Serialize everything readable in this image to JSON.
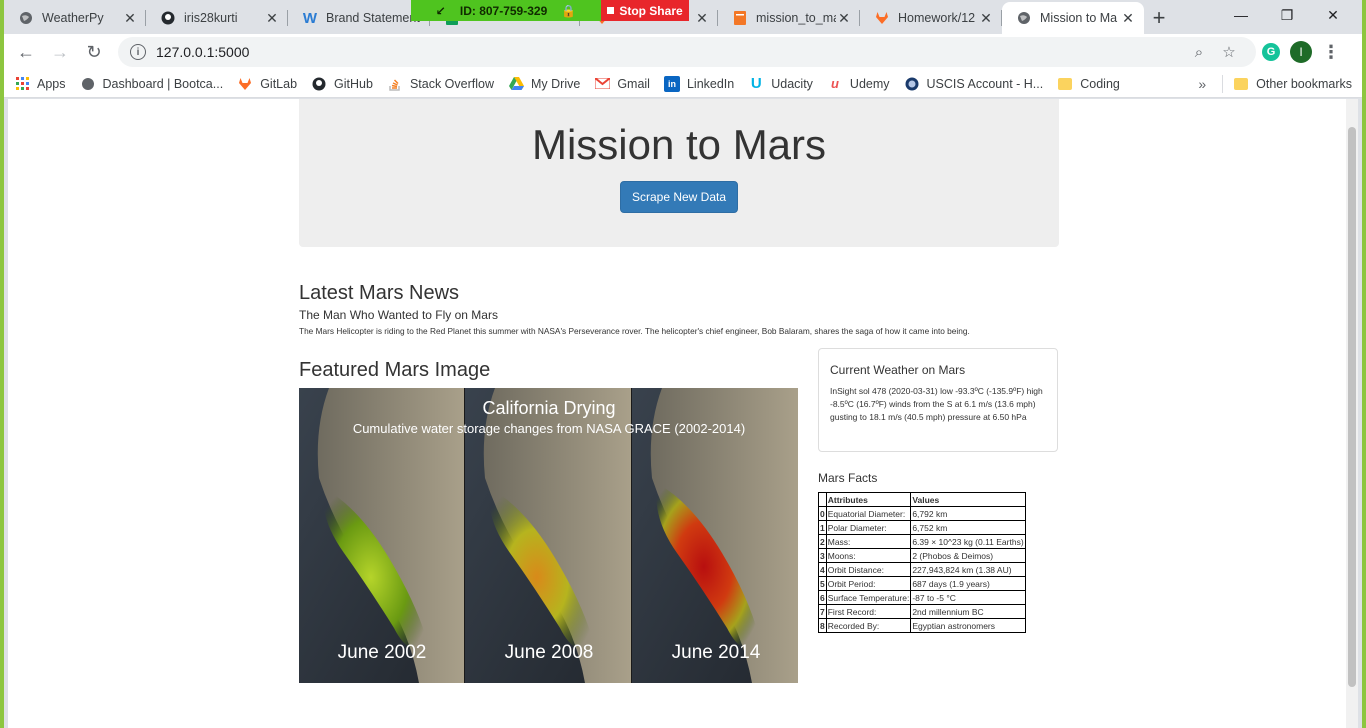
{
  "browser": {
    "tabs": [
      {
        "label": "WeatherPy",
        "icon": "globe-icon"
      },
      {
        "label": "iris28kurti",
        "icon": "github-icon"
      },
      {
        "label": "Brand Statement",
        "icon": "word-icon"
      },
      {
        "label": "",
        "icon": "sheets-icon"
      },
      {
        "label": "",
        "icon": "gitlab-icon"
      },
      {
        "label": "mission_to_ma",
        "icon": "book-icon"
      },
      {
        "label": "Homework/12",
        "icon": "gitlab-icon"
      },
      {
        "label": "Mission to Ma",
        "icon": "globe-icon"
      }
    ],
    "share": {
      "id": "ID: 807-759-329",
      "stop": "Stop Share"
    },
    "url": "127.0.0.1:5000",
    "profile_initial": "I",
    "bookmarks": [
      {
        "label": "Apps",
        "icon": "apps-grid-icon"
      },
      {
        "label": "Dashboard | Bootca...",
        "icon": "globe-icon"
      },
      {
        "label": "GitLab",
        "icon": "gitlab-icon"
      },
      {
        "label": "GitHub",
        "icon": "github-icon"
      },
      {
        "label": "Stack Overflow",
        "icon": "stackoverflow-icon"
      },
      {
        "label": "My Drive",
        "icon": "drive-icon"
      },
      {
        "label": "Gmail",
        "icon": "gmail-icon"
      },
      {
        "label": "LinkedIn",
        "icon": "linkedin-icon"
      },
      {
        "label": "Udacity",
        "icon": "udacity-icon"
      },
      {
        "label": "Udemy",
        "icon": "udemy-icon"
      },
      {
        "label": "USCIS Account - H...",
        "icon": "seal-icon"
      },
      {
        "label": "Coding",
        "icon": "folder-icon"
      }
    ],
    "other_bookmarks": "Other bookmarks"
  },
  "page": {
    "title": "Mission to Mars",
    "scrape_button": "Scrape New Data",
    "news_heading": "Latest Mars News",
    "news_title": "The Man Who Wanted to Fly on Mars",
    "news_paragraph": "The Mars Helicopter is riding to the Red Planet this summer with NASA's Perseverance rover. The helicopter's chief engineer, Bob Balaram, shares the saga of how it came into being.",
    "featured_heading": "Featured Mars Image",
    "featured_image": {
      "title": "California Drying",
      "subtitle": "Cumulative water storage changes from NASA GRACE (2002-2014)",
      "panels": [
        "June 2002",
        "June 2008",
        "June 2014"
      ]
    },
    "weather": {
      "heading": "Current Weather on Mars",
      "text": "InSight sol 478 (2020-03-31) low -93.3ºC (-135.9ºF) high -8.5ºC (16.7ºF) winds from the S at 6.1 m/s (13.6 mph) gusting to 18.1 m/s (40.5 mph) pressure at 6.50 hPa"
    },
    "facts": {
      "heading": "Mars Facts",
      "columns": [
        "Attributes",
        "Values"
      ],
      "rows": [
        {
          "idx": "0",
          "attr": "Equatorial Diameter:",
          "val": "6,792 km"
        },
        {
          "idx": "1",
          "attr": "Polar Diameter:",
          "val": "6,752 km"
        },
        {
          "idx": "2",
          "attr": "Mass:",
          "val": "6.39 × 10^23 kg (0.11 Earths)"
        },
        {
          "idx": "3",
          "attr": "Moons:",
          "val": "2 (Phobos & Deimos)"
        },
        {
          "idx": "4",
          "attr": "Orbit Distance:",
          "val": "227,943,824 km (1.38 AU)"
        },
        {
          "idx": "5",
          "attr": "Orbit Period:",
          "val": "687 days (1.9 years)"
        },
        {
          "idx": "6",
          "attr": "Surface Temperature:",
          "val": "-87 to -5 °C"
        },
        {
          "idx": "7",
          "attr": "First Record:",
          "val": "2nd millennium BC"
        },
        {
          "idx": "8",
          "attr": "Recorded By:",
          "val": "Egyptian astronomers"
        }
      ]
    }
  }
}
